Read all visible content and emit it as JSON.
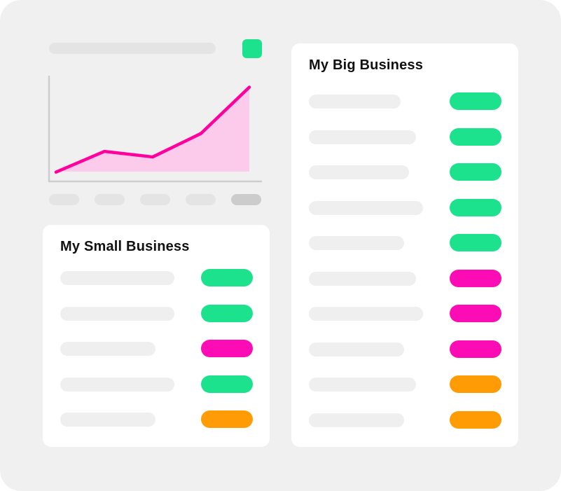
{
  "colors": {
    "frame": "#f0f0f0",
    "placeholder": "#efefef",
    "placeholder_dark": "#cccccc",
    "green": "#1de28d",
    "pink": "#fc0cb5",
    "orange": "#ff9b05",
    "line": "#ff009d",
    "area": "#fccaea",
    "axis": "#cdcdcd"
  },
  "chart": {
    "badge_color": "green",
    "tick_colors": [
      "placeholder",
      "placeholder",
      "placeholder",
      "placeholder",
      "placeholder_dark"
    ]
  },
  "chart_data": {
    "type": "area",
    "title": "",
    "xlabel": "",
    "ylabel": "",
    "x": [
      1,
      2,
      3,
      4,
      5
    ],
    "values": [
      1.0,
      4.0,
      3.2,
      6.6,
      13.3
    ],
    "ylim": [
      0,
      14
    ],
    "grid": false,
    "legend": "none"
  },
  "small_business": {
    "title": "My Small Business",
    "rows": [
      {
        "status": "green"
      },
      {
        "status": "green"
      },
      {
        "status": "pink"
      },
      {
        "status": "green"
      },
      {
        "status": "orange"
      }
    ]
  },
  "big_business": {
    "title": "My Big Business",
    "rows": [
      {
        "status": "green"
      },
      {
        "status": "green"
      },
      {
        "status": "green"
      },
      {
        "status": "green"
      },
      {
        "status": "green"
      },
      {
        "status": "pink"
      },
      {
        "status": "pink"
      },
      {
        "status": "pink"
      },
      {
        "status": "orange"
      },
      {
        "status": "orange"
      }
    ]
  }
}
